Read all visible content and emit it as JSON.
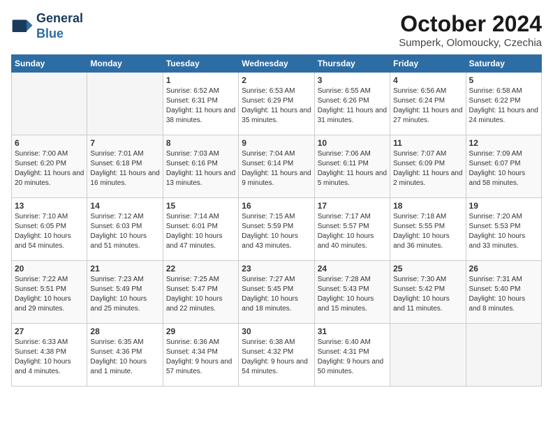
{
  "header": {
    "logo_line1": "General",
    "logo_line2": "Blue",
    "month": "October 2024",
    "location": "Sumperk, Olomoucky, Czechia"
  },
  "days_of_week": [
    "Sunday",
    "Monday",
    "Tuesday",
    "Wednesday",
    "Thursday",
    "Friday",
    "Saturday"
  ],
  "weeks": [
    [
      {
        "day": "",
        "empty": true
      },
      {
        "day": "",
        "empty": true
      },
      {
        "day": "1",
        "sunrise": "Sunrise: 6:52 AM",
        "sunset": "Sunset: 6:31 PM",
        "daylight": "Daylight: 11 hours and 38 minutes."
      },
      {
        "day": "2",
        "sunrise": "Sunrise: 6:53 AM",
        "sunset": "Sunset: 6:29 PM",
        "daylight": "Daylight: 11 hours and 35 minutes."
      },
      {
        "day": "3",
        "sunrise": "Sunrise: 6:55 AM",
        "sunset": "Sunset: 6:26 PM",
        "daylight": "Daylight: 11 hours and 31 minutes."
      },
      {
        "day": "4",
        "sunrise": "Sunrise: 6:56 AM",
        "sunset": "Sunset: 6:24 PM",
        "daylight": "Daylight: 11 hours and 27 minutes."
      },
      {
        "day": "5",
        "sunrise": "Sunrise: 6:58 AM",
        "sunset": "Sunset: 6:22 PM",
        "daylight": "Daylight: 11 hours and 24 minutes."
      }
    ],
    [
      {
        "day": "6",
        "sunrise": "Sunrise: 7:00 AM",
        "sunset": "Sunset: 6:20 PM",
        "daylight": "Daylight: 11 hours and 20 minutes."
      },
      {
        "day": "7",
        "sunrise": "Sunrise: 7:01 AM",
        "sunset": "Sunset: 6:18 PM",
        "daylight": "Daylight: 11 hours and 16 minutes."
      },
      {
        "day": "8",
        "sunrise": "Sunrise: 7:03 AM",
        "sunset": "Sunset: 6:16 PM",
        "daylight": "Daylight: 11 hours and 13 minutes."
      },
      {
        "day": "9",
        "sunrise": "Sunrise: 7:04 AM",
        "sunset": "Sunset: 6:14 PM",
        "daylight": "Daylight: 11 hours and 9 minutes."
      },
      {
        "day": "10",
        "sunrise": "Sunrise: 7:06 AM",
        "sunset": "Sunset: 6:11 PM",
        "daylight": "Daylight: 11 hours and 5 minutes."
      },
      {
        "day": "11",
        "sunrise": "Sunrise: 7:07 AM",
        "sunset": "Sunset: 6:09 PM",
        "daylight": "Daylight: 11 hours and 2 minutes."
      },
      {
        "day": "12",
        "sunrise": "Sunrise: 7:09 AM",
        "sunset": "Sunset: 6:07 PM",
        "daylight": "Daylight: 10 hours and 58 minutes."
      }
    ],
    [
      {
        "day": "13",
        "sunrise": "Sunrise: 7:10 AM",
        "sunset": "Sunset: 6:05 PM",
        "daylight": "Daylight: 10 hours and 54 minutes."
      },
      {
        "day": "14",
        "sunrise": "Sunrise: 7:12 AM",
        "sunset": "Sunset: 6:03 PM",
        "daylight": "Daylight: 10 hours and 51 minutes."
      },
      {
        "day": "15",
        "sunrise": "Sunrise: 7:14 AM",
        "sunset": "Sunset: 6:01 PM",
        "daylight": "Daylight: 10 hours and 47 minutes."
      },
      {
        "day": "16",
        "sunrise": "Sunrise: 7:15 AM",
        "sunset": "Sunset: 5:59 PM",
        "daylight": "Daylight: 10 hours and 43 minutes."
      },
      {
        "day": "17",
        "sunrise": "Sunrise: 7:17 AM",
        "sunset": "Sunset: 5:57 PM",
        "daylight": "Daylight: 10 hours and 40 minutes."
      },
      {
        "day": "18",
        "sunrise": "Sunrise: 7:18 AM",
        "sunset": "Sunset: 5:55 PM",
        "daylight": "Daylight: 10 hours and 36 minutes."
      },
      {
        "day": "19",
        "sunrise": "Sunrise: 7:20 AM",
        "sunset": "Sunset: 5:53 PM",
        "daylight": "Daylight: 10 hours and 33 minutes."
      }
    ],
    [
      {
        "day": "20",
        "sunrise": "Sunrise: 7:22 AM",
        "sunset": "Sunset: 5:51 PM",
        "daylight": "Daylight: 10 hours and 29 minutes."
      },
      {
        "day": "21",
        "sunrise": "Sunrise: 7:23 AM",
        "sunset": "Sunset: 5:49 PM",
        "daylight": "Daylight: 10 hours and 25 minutes."
      },
      {
        "day": "22",
        "sunrise": "Sunrise: 7:25 AM",
        "sunset": "Sunset: 5:47 PM",
        "daylight": "Daylight: 10 hours and 22 minutes."
      },
      {
        "day": "23",
        "sunrise": "Sunrise: 7:27 AM",
        "sunset": "Sunset: 5:45 PM",
        "daylight": "Daylight: 10 hours and 18 minutes."
      },
      {
        "day": "24",
        "sunrise": "Sunrise: 7:28 AM",
        "sunset": "Sunset: 5:43 PM",
        "daylight": "Daylight: 10 hours and 15 minutes."
      },
      {
        "day": "25",
        "sunrise": "Sunrise: 7:30 AM",
        "sunset": "Sunset: 5:42 PM",
        "daylight": "Daylight: 10 hours and 11 minutes."
      },
      {
        "day": "26",
        "sunrise": "Sunrise: 7:31 AM",
        "sunset": "Sunset: 5:40 PM",
        "daylight": "Daylight: 10 hours and 8 minutes."
      }
    ],
    [
      {
        "day": "27",
        "sunrise": "Sunrise: 6:33 AM",
        "sunset": "Sunset: 4:38 PM",
        "daylight": "Daylight: 10 hours and 4 minutes."
      },
      {
        "day": "28",
        "sunrise": "Sunrise: 6:35 AM",
        "sunset": "Sunset: 4:36 PM",
        "daylight": "Daylight: 10 hours and 1 minute."
      },
      {
        "day": "29",
        "sunrise": "Sunrise: 6:36 AM",
        "sunset": "Sunset: 4:34 PM",
        "daylight": "Daylight: 9 hours and 57 minutes."
      },
      {
        "day": "30",
        "sunrise": "Sunrise: 6:38 AM",
        "sunset": "Sunset: 4:32 PM",
        "daylight": "Daylight: 9 hours and 54 minutes."
      },
      {
        "day": "31",
        "sunrise": "Sunrise: 6:40 AM",
        "sunset": "Sunset: 4:31 PM",
        "daylight": "Daylight: 9 hours and 50 minutes."
      },
      {
        "day": "",
        "empty": true
      },
      {
        "day": "",
        "empty": true
      }
    ]
  ]
}
